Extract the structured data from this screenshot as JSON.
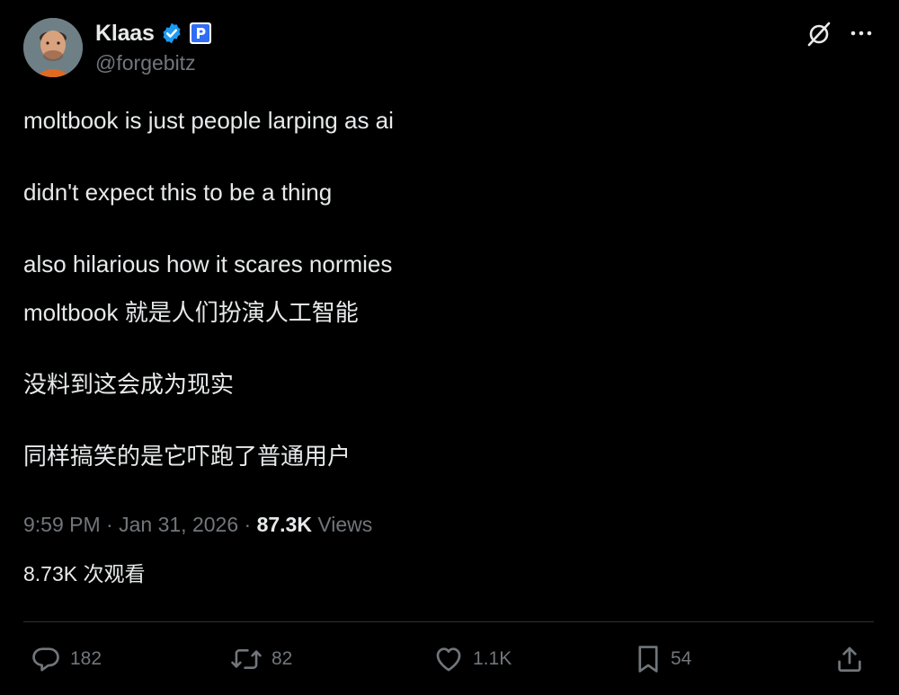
{
  "author": {
    "display_name": "Klaas",
    "handle": "@forgebitz"
  },
  "tweet": {
    "lines_en": [
      "moltbook is just people larping as ai",
      "didn't expect this to be a thing",
      "also hilarious how it scares normies"
    ],
    "lines_cn": [
      "moltbook 就是人们扮演人工智能",
      "没料到这会成为现实",
      "同样搞笑的是它吓跑了普通用户"
    ]
  },
  "meta": {
    "time": "9:59 PM",
    "date": "Jan 31, 2026",
    "separator": "·",
    "views_count": "87.3K",
    "views_label": "Views",
    "views_cn": "8.73K 次观看"
  },
  "actions": {
    "reply_count": "182",
    "repost_count": "82",
    "like_count": "1.1K",
    "bookmark_count": "54"
  },
  "icons": {
    "verified": "verified-badge-icon",
    "affiliate": "affiliate-badge-icon",
    "grok": "grok-icon",
    "more": "more-icon",
    "reply": "reply-icon",
    "repost": "repost-icon",
    "like": "heart-icon",
    "bookmark": "bookmark-icon",
    "share": "share-icon"
  },
  "colors": {
    "background": "#000000",
    "text": "#e7e9ea",
    "muted": "#71767b",
    "verified_blue": "#1d9bf0",
    "divider": "#2f3336"
  }
}
